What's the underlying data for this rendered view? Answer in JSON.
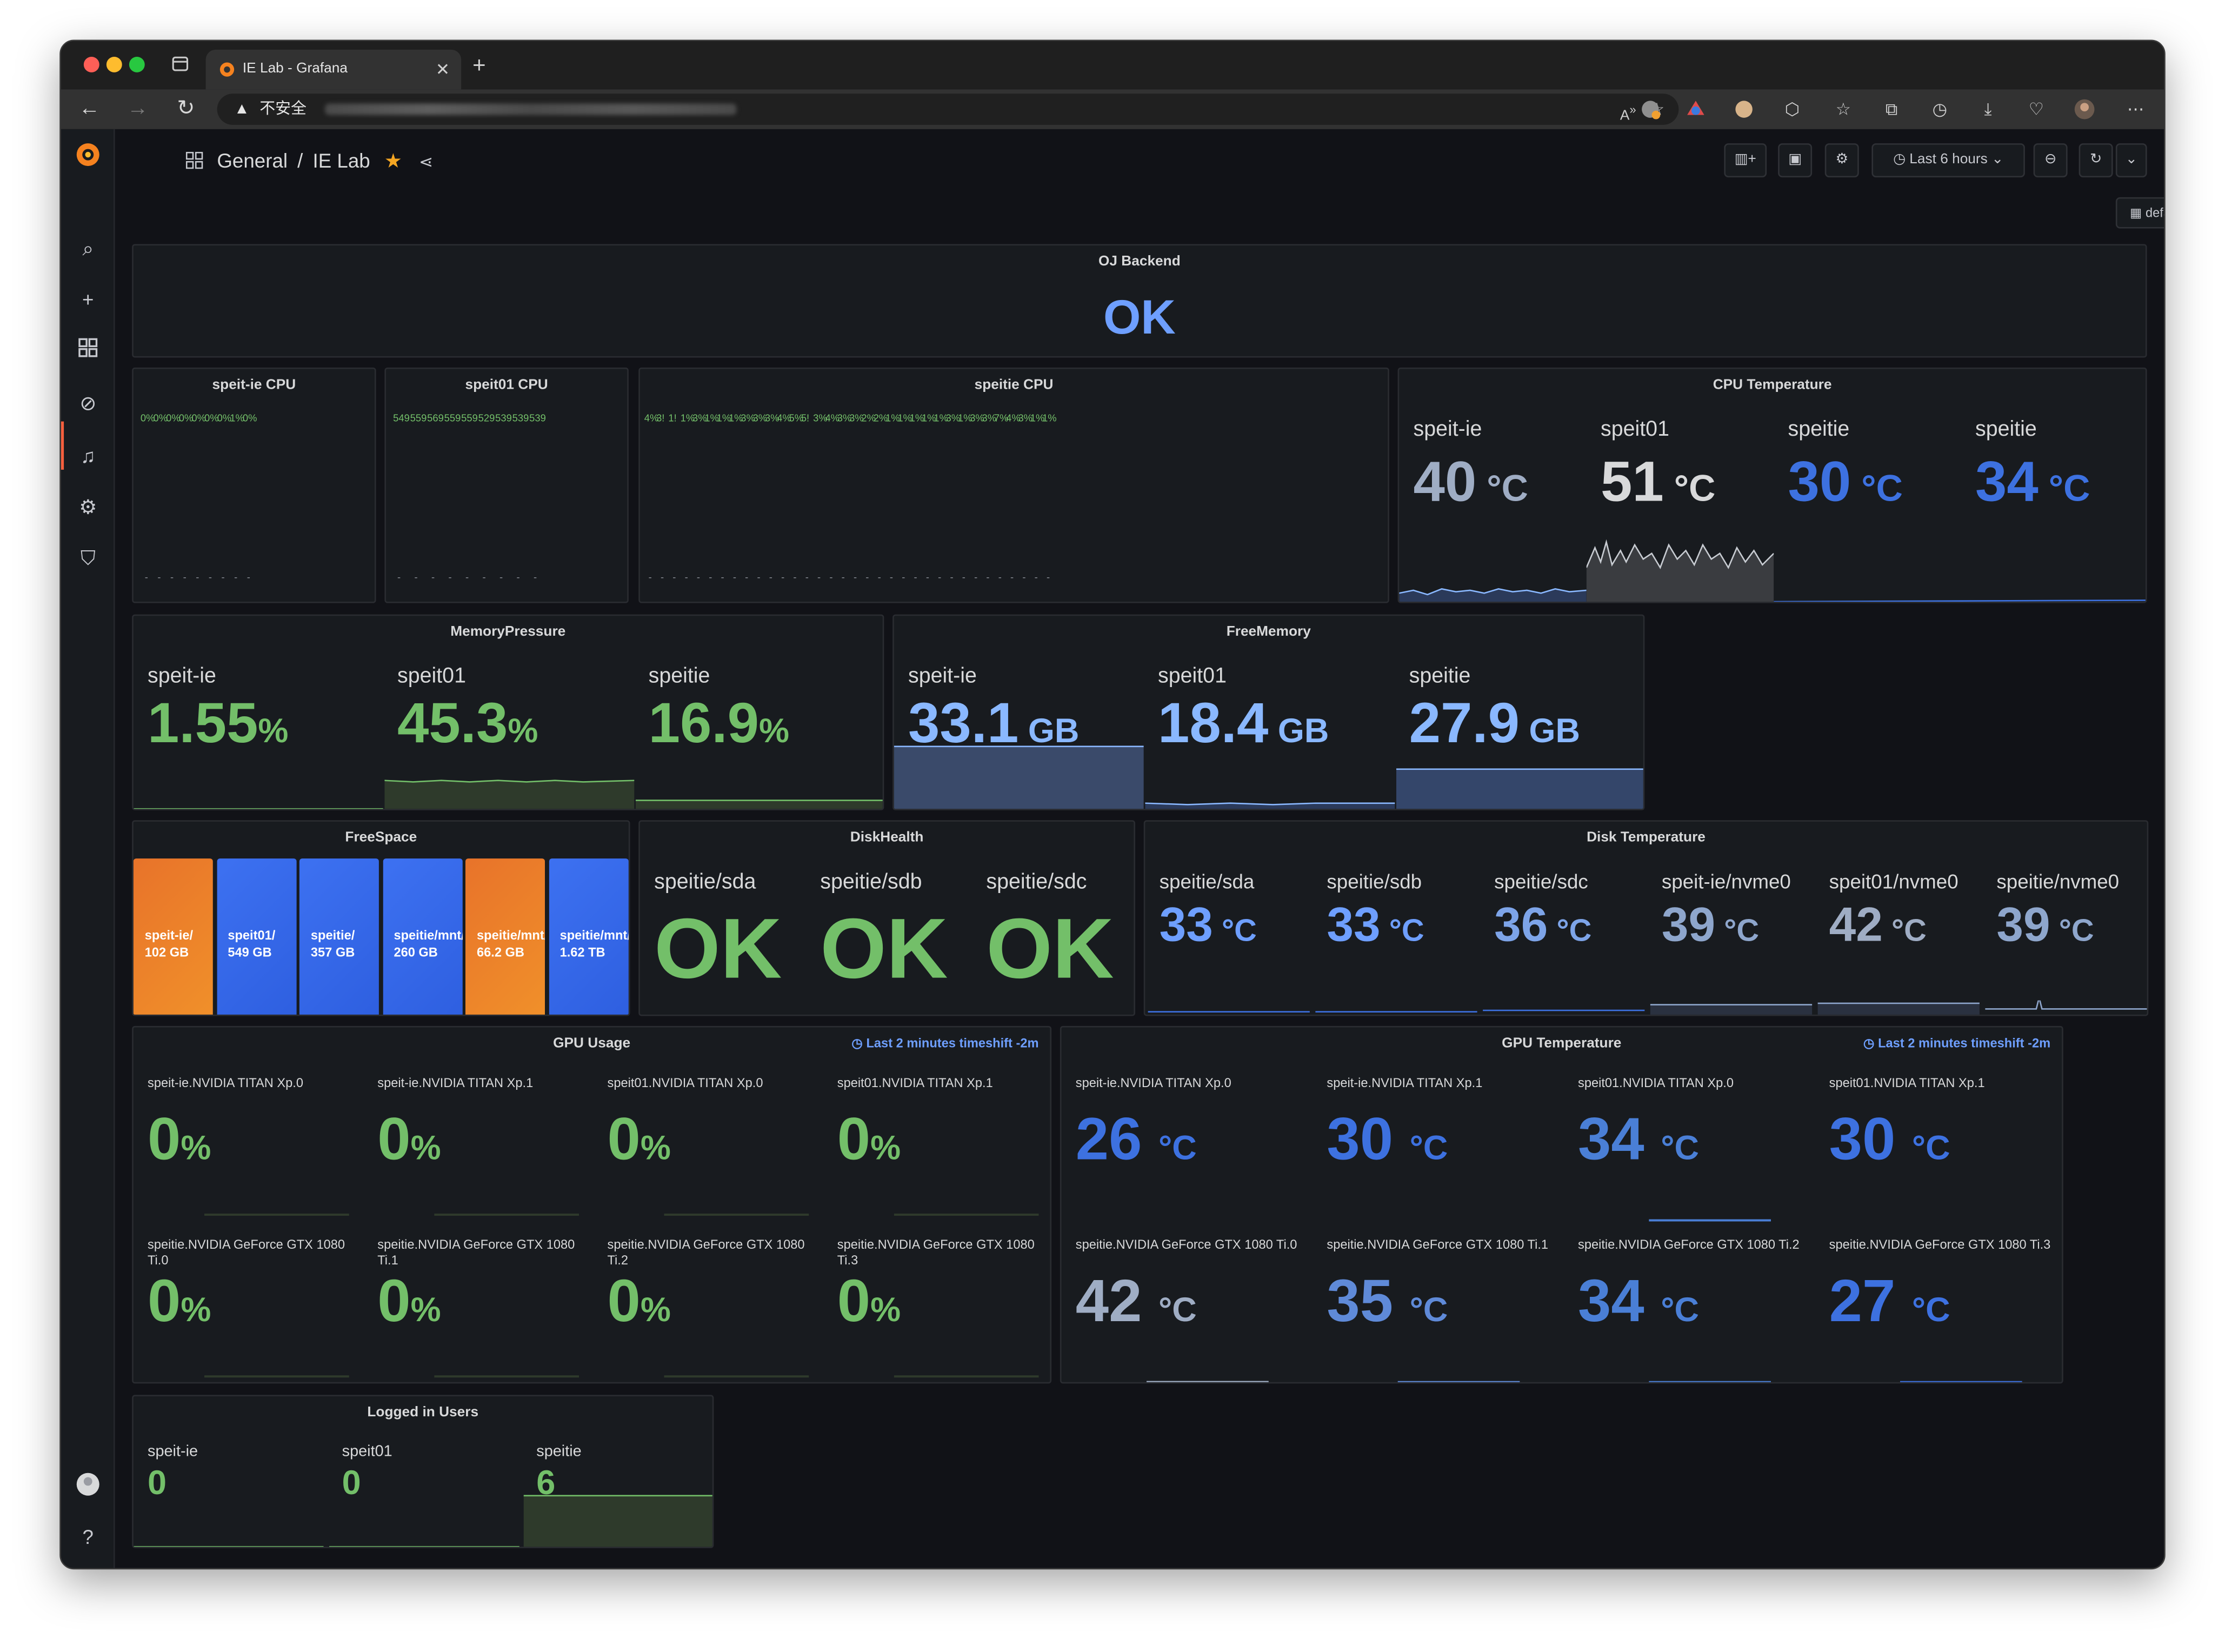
{
  "browser": {
    "tab_title": "IE Lab - Grafana",
    "security_label": "不安全",
    "new_tab_symbol": "+"
  },
  "dashboard": {
    "breadcrumb_folder": "General",
    "breadcrumb_sep": "/",
    "breadcrumb_title": "IE Lab",
    "time_range": "Last 6 hours",
    "view_mode": "default"
  },
  "panels": {
    "oj_backend": {
      "title": "OJ Backend",
      "value": "OK"
    },
    "speit_ie_cpu": {
      "title": "speit-ie CPU",
      "labels": [
        "0%",
        "0%",
        "0%",
        "0%",
        "0%",
        "0%",
        "0%",
        "1%",
        "0%"
      ],
      "levels": [
        0.005,
        0.005,
        0.005,
        0.005,
        0.005,
        0.005,
        0.005,
        0.01,
        0.005
      ]
    },
    "speit01_cpu": {
      "title": "speit01 CPU",
      "labels": [
        "549",
        "559",
        "569",
        "559",
        "559",
        "529",
        "539",
        "539",
        "539"
      ],
      "levels": [
        0.54,
        0.55,
        0.56,
        0.55,
        0.55,
        0.52,
        0.53,
        0.53,
        0.53
      ]
    },
    "speitie_cpu": {
      "title": "speitie CPU",
      "labels": [
        "4%",
        "3!",
        "1!",
        "1%",
        "3%",
        "1%",
        "1%",
        "1%",
        "3%",
        "3%",
        "3%",
        "4%",
        "5%",
        "5!",
        "3%",
        "4%",
        "3%",
        "3%",
        "2%",
        "2%",
        "1%",
        "1%",
        "1%",
        "1%",
        "1%",
        "3%",
        "1%",
        "3%",
        "3%",
        "7%",
        "4%",
        "3%",
        "1%",
        "1%"
      ],
      "levels": [
        0.01,
        0.11,
        0.1,
        0.01,
        0.01,
        0.01,
        0.01,
        0.01,
        0.01,
        0.01,
        0.01,
        0.02,
        0.03,
        0.05,
        0.13,
        0.11,
        0.02,
        0.01,
        0.01,
        0.01,
        0.01,
        0.01,
        0.01,
        0.01,
        0.01,
        0.01,
        0.06,
        0.01,
        0.01,
        0.05,
        0.06,
        0.02,
        0.01,
        0.01
      ]
    },
    "cpu_temperature": {
      "title": "CPU Temperature",
      "items": [
        {
          "label": "speit-ie",
          "value": "40",
          "unit": "°C"
        },
        {
          "label": "speit01",
          "value": "51",
          "unit": "°C"
        },
        {
          "label": "speitie",
          "value": "30",
          "unit": "°C"
        },
        {
          "label": "speitie",
          "value": "34",
          "unit": "°C"
        }
      ]
    },
    "memory_pressure": {
      "title": "MemoryPressure",
      "items": [
        {
          "label": "speit-ie",
          "value": "1.55",
          "unit": "%"
        },
        {
          "label": "speit01",
          "value": "45.3",
          "unit": "%"
        },
        {
          "label": "speitie",
          "value": "16.9",
          "unit": "%"
        }
      ]
    },
    "free_memory": {
      "title": "FreeMemory",
      "items": [
        {
          "label": "speit-ie",
          "value": "33.1",
          "unit": "GB"
        },
        {
          "label": "speit01",
          "value": "18.4",
          "unit": "GB"
        },
        {
          "label": "speitie",
          "value": "27.9",
          "unit": "GB"
        }
      ]
    },
    "free_space": {
      "title": "FreeSpace",
      "tiles": [
        {
          "name": "speit-ie/",
          "value": "102 GB",
          "color": "#e8732a"
        },
        {
          "name": "speit01/",
          "value": "549 GB",
          "color": "#3d71f1"
        },
        {
          "name": "speitie/",
          "value": "357 GB",
          "color": "#3d71f1"
        },
        {
          "name": "speitie/mnt/",
          "value": "260 GB",
          "color": "#3d71f1"
        },
        {
          "name": "speitie/mnt/",
          "value": "66.2 GB",
          "color": "#e8732a"
        },
        {
          "name": "speitie/mnt/",
          "value": "1.62 TB",
          "color": "#3d71f1"
        }
      ]
    },
    "disk_health": {
      "title": "DiskHealth",
      "items": [
        {
          "label": "speitie/sda",
          "value": "OK"
        },
        {
          "label": "speitie/sdb",
          "value": "OK"
        },
        {
          "label": "speitie/sdc",
          "value": "OK"
        }
      ]
    },
    "disk_temperature": {
      "title": "Disk Temperature",
      "items": [
        {
          "label": "speitie/sda",
          "value": "33",
          "unit": "°C"
        },
        {
          "label": "speitie/sdb",
          "value": "33",
          "unit": "°C"
        },
        {
          "label": "speitie/sdc",
          "value": "36",
          "unit": "°C"
        },
        {
          "label": "speit-ie/nvme0",
          "value": "39",
          "unit": "°C"
        },
        {
          "label": "speit01/nvme0",
          "value": "42",
          "unit": "°C"
        },
        {
          "label": "speitie/nvme0",
          "value": "39",
          "unit": "°C"
        }
      ]
    },
    "gpu_usage": {
      "title": "GPU Usage",
      "note": "Last 2 minutes timeshift -2m",
      "items": [
        {
          "label": "speit-ie.NVIDIA TITAN Xp.0",
          "value": "0",
          "unit": "%"
        },
        {
          "label": "speit-ie.NVIDIA TITAN Xp.1",
          "value": "0",
          "unit": "%"
        },
        {
          "label": "speit01.NVIDIA TITAN Xp.0",
          "value": "0",
          "unit": "%"
        },
        {
          "label": "speit01.NVIDIA TITAN Xp.1",
          "value": "0",
          "unit": "%"
        },
        {
          "label": "speitie.NVIDIA GeForce GTX 1080 Ti.0",
          "value": "0",
          "unit": "%"
        },
        {
          "label": "speitie.NVIDIA GeForce GTX 1080 Ti.1",
          "value": "0",
          "unit": "%"
        },
        {
          "label": "speitie.NVIDIA GeForce GTX 1080 Ti.2",
          "value": "0",
          "unit": "%"
        },
        {
          "label": "speitie.NVIDIA GeForce GTX 1080 Ti.3",
          "value": "0",
          "unit": "%"
        }
      ]
    },
    "gpu_temperature": {
      "title": "GPU Temperature",
      "note": "Last 2 minutes timeshift -2m",
      "items": [
        {
          "label": "speit-ie.NVIDIA TITAN Xp.0",
          "value": "26",
          "unit": "°C"
        },
        {
          "label": "speit-ie.NVIDIA TITAN Xp.1",
          "value": "30",
          "unit": "°C"
        },
        {
          "label": "speit01.NVIDIA TITAN Xp.0",
          "value": "34",
          "unit": "°C"
        },
        {
          "label": "speit01.NVIDIA TITAN Xp.1",
          "value": "30",
          "unit": "°C"
        },
        {
          "label": "speitie.NVIDIA GeForce GTX 1080 Ti.0",
          "value": "42",
          "unit": "°C"
        },
        {
          "label": "speitie.NVIDIA GeForce GTX 1080 Ti.1",
          "value": "35",
          "unit": "°C"
        },
        {
          "label": "speitie.NVIDIA GeForce GTX 1080 Ti.2",
          "value": "34",
          "unit": "°C"
        },
        {
          "label": "speitie.NVIDIA GeForce GTX 1080 Ti.3",
          "value": "27",
          "unit": "°C"
        }
      ]
    },
    "logged_in_users": {
      "title": "Logged in Users",
      "items": [
        {
          "label": "speit-ie",
          "value": "0"
        },
        {
          "label": "speit01",
          "value": "0"
        },
        {
          "label": "speitie",
          "value": "6"
        }
      ]
    }
  },
  "colors": {
    "ok_green": "#73bf69",
    "value_blue": "#5794f2",
    "grafana_orange": "#f55f3e",
    "panel_bg": "#181b1f"
  }
}
